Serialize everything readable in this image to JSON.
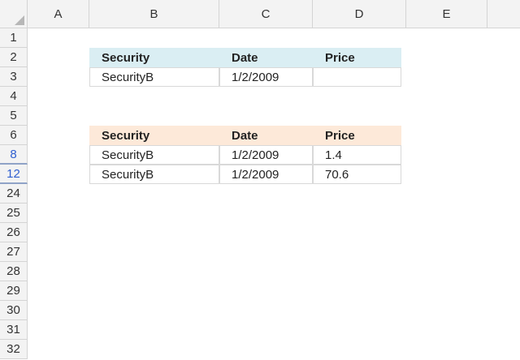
{
  "columns": [
    "A",
    "B",
    "C",
    "D",
    "E"
  ],
  "rows": [
    {
      "label": "1",
      "filtered": false
    },
    {
      "label": "2",
      "filtered": false
    },
    {
      "label": "3",
      "filtered": false
    },
    {
      "label": "4",
      "filtered": false
    },
    {
      "label": "5",
      "filtered": false
    },
    {
      "label": "6",
      "filtered": false
    },
    {
      "label": "8",
      "filtered": true
    },
    {
      "label": "12",
      "filtered": true
    },
    {
      "label": "24",
      "filtered": false
    },
    {
      "label": "25",
      "filtered": false
    },
    {
      "label": "26",
      "filtered": false
    },
    {
      "label": "27",
      "filtered": false
    },
    {
      "label": "28",
      "filtered": false
    },
    {
      "label": "29",
      "filtered": false
    },
    {
      "label": "30",
      "filtered": false
    },
    {
      "label": "31",
      "filtered": false
    },
    {
      "label": "32",
      "filtered": false
    }
  ],
  "table1": {
    "header_color": "#daeef3",
    "headers": [
      "Security",
      "Date",
      "Price"
    ],
    "rows": [
      [
        "SecurityB",
        "1/2/2009",
        ""
      ]
    ]
  },
  "table2": {
    "header_color": "#fde9d9",
    "headers": [
      "Security",
      "Date",
      "Price"
    ],
    "rows": [
      [
        "SecurityB",
        "1/2/2009",
        "1.4"
      ],
      [
        "SecurityB",
        "1/2/2009",
        "70.6"
      ]
    ]
  },
  "filtered_row_color": "#2f5fd0"
}
